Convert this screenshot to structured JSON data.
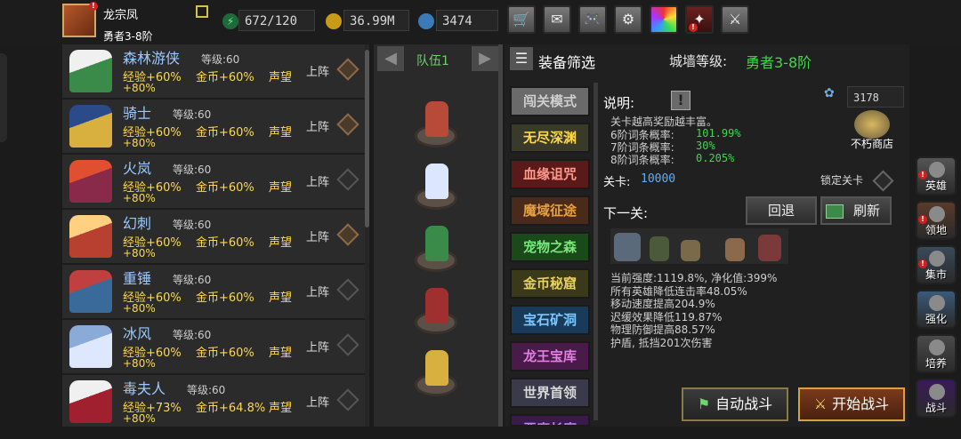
{
  "player": {
    "name": "龙宗凤",
    "rank": "勇者3-8阶"
  },
  "resources": {
    "stamina": "672/120",
    "gold": "36.99M",
    "gems": "3474"
  },
  "heroes": [
    {
      "name": "森林游侠",
      "level_label": "等级:60",
      "exp": "经验+60%",
      "gold": "金币+60%",
      "fame": "声望",
      "extra": "+80%",
      "deploy": "上阵",
      "active": true
    },
    {
      "name": "骑士",
      "level_label": "等级:60",
      "exp": "经验+60%",
      "gold": "金币+60%",
      "fame": "声望",
      "extra": "+80%",
      "deploy": "上阵",
      "active": true
    },
    {
      "name": "火岚",
      "level_label": "等级:60",
      "exp": "经验+60%",
      "gold": "金币+60%",
      "fame": "声望",
      "extra": "+80%",
      "deploy": "上阵",
      "active": false
    },
    {
      "name": "幻刺",
      "level_label": "等级:60",
      "exp": "经验+60%",
      "gold": "金币+60%",
      "fame": "声望",
      "extra": "+80%",
      "deploy": "上阵",
      "active": true
    },
    {
      "name": "重锤",
      "level_label": "等级:60",
      "exp": "经验+60%",
      "gold": "金币+60%",
      "fame": "声望",
      "extra": "+80%",
      "deploy": "上阵",
      "active": false
    },
    {
      "name": "冰风",
      "level_label": "等级:60",
      "exp": "经验+60%",
      "gold": "金币+60%",
      "fame": "声望",
      "extra": "+80%",
      "deploy": "上阵",
      "active": false
    },
    {
      "name": "毒夫人",
      "level_label": "等级:60",
      "exp": "经验+73%",
      "gold": "金币+64.8%",
      "fame": "声望",
      "extra": "+80%",
      "deploy": "上阵",
      "active": false
    }
  ],
  "team": {
    "label": "队伍1"
  },
  "panel": {
    "filter_label": "装备筛选",
    "wall_level_label": "城墙等级:",
    "wall_level_value": "勇者3-8阶",
    "modes": [
      "闯关模式",
      "无尽深渊",
      "血缘诅咒",
      "魔域征途",
      "宠物之森",
      "金币秘窟",
      "宝石矿洞",
      "龙王宝库",
      "世界首领",
      "恶魔长廊"
    ],
    "desc_label": "说明:",
    "desc_line": "关卡越高奖励越丰富。",
    "rates": [
      {
        "label": "6阶词条概率:",
        "value": "101.99%"
      },
      {
        "label": "7阶词条概率:",
        "value": "30%"
      },
      {
        "label": "8阶词条概率:",
        "value": "0.205%"
      }
    ],
    "currency_value": "3178",
    "shop_label": "不朽商店",
    "stage_label": "关卡:",
    "stage_value": "10000",
    "lock_label": "锁定关卡",
    "next_label": "下一关:",
    "back_button": "回退",
    "refresh_button": "刷新",
    "enemy_stats": [
      "当前强度:1119.8%, 净化值:399%",
      "所有英雄降低连击率48.05%",
      "移动速度提高204.9%",
      "迟缓效果降低119.87%",
      "物理防御提高88.57%",
      "护盾, 抵挡201次伤害"
    ],
    "auto_battle": "自动战斗",
    "start_battle": "开始战斗"
  },
  "side_menu": [
    "英雄",
    "领地",
    "集市",
    "强化",
    "培养",
    "战斗"
  ]
}
